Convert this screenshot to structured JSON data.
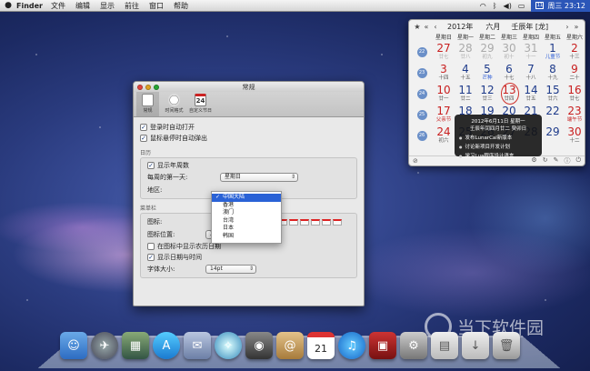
{
  "menubar": {
    "app_name": "Finder",
    "items": [
      "文件",
      "编辑",
      "显示",
      "前往",
      "窗口",
      "帮助"
    ],
    "clock": "周三 23:12",
    "clock_icon": "calendar-icon"
  },
  "calendar": {
    "year": "2012年",
    "month": "六月",
    "ganzhi": "壬辰年 [龙]",
    "weekdays": [
      "星期日",
      "星期一",
      "星期二",
      "星期三",
      "星期四",
      "星期五",
      "星期六"
    ],
    "weeks": [
      {
        "num": "22",
        "days": [
          [
            "27",
            "廿七",
            1
          ],
          [
            "28",
            "廿八",
            1
          ],
          [
            "29",
            "初九",
            1
          ],
          [
            "30",
            "初十",
            1
          ],
          [
            "31",
            "十一",
            1
          ],
          [
            "1",
            "儿童节",
            0
          ],
          [
            "2",
            "十三",
            0
          ]
        ]
      },
      {
        "num": "23",
        "days": [
          [
            "3",
            "十四",
            0
          ],
          [
            "4",
            "十五",
            0
          ],
          [
            "5",
            "芒种",
            0
          ],
          [
            "6",
            "十七",
            0
          ],
          [
            "7",
            "十八",
            0
          ],
          [
            "8",
            "十九",
            0
          ],
          [
            "9",
            "二十",
            0
          ]
        ]
      },
      {
        "num": "24",
        "days": [
          [
            "10",
            "廿一",
            0
          ],
          [
            "11",
            "廿二",
            0
          ],
          [
            "12",
            "廿三",
            0
          ],
          [
            "13",
            "廿四",
            0
          ],
          [
            "14",
            "廿五",
            0
          ],
          [
            "15",
            "廿六",
            0
          ],
          [
            "16",
            "廿七",
            0
          ]
        ]
      },
      {
        "num": "25",
        "days": [
          [
            "17",
            "父亲节",
            0
          ],
          [
            "18",
            "",
            0
          ],
          [
            "19",
            "",
            0
          ],
          [
            "20",
            "",
            0
          ],
          [
            "21",
            "",
            0
          ],
          [
            "22",
            "",
            0
          ],
          [
            "23",
            "端午节",
            0
          ]
        ]
      },
      {
        "num": "26",
        "days": [
          [
            "24",
            "初六",
            0
          ],
          [
            "25",
            "",
            0
          ],
          [
            "26",
            "",
            0
          ],
          [
            "27",
            "",
            0
          ],
          [
            "28",
            "",
            0
          ],
          [
            "29",
            "",
            0
          ],
          [
            "30",
            "十二",
            0
          ]
        ]
      }
    ],
    "tooltip": {
      "title": "2012年6月11日 星期一",
      "subtitle": "壬辰年闰四月廿二 癸卯日",
      "items": [
        "发布LunarCal新版本",
        "讨论新项目开发计划",
        "学习Lua程序设计语言"
      ]
    }
  },
  "prefs": {
    "title": "常规",
    "toolbar": [
      "常规",
      "时间格式",
      "自定义节日"
    ],
    "options": {
      "login_open": "登录时自动打开",
      "hover_popup": "鼠标悬停时自动弹出"
    },
    "calendar_group": {
      "label": "日历",
      "show_weeknum": "显示年周数",
      "first_day_label": "每周的第一天:",
      "first_day_value": "星期日",
      "region_label": "地区:"
    },
    "menubar_group": {
      "label": "菜单栏",
      "icon_label": "图标:",
      "icon_pos_label": "图标位置:",
      "icon_pos_value": "左",
      "show_lunar": "在图标中显示农历日期",
      "show_datetime": "显示日期与时间",
      "font_size_label": "字体大小:",
      "font_size_value": "14pt"
    },
    "region_options": [
      "中国大陆",
      "香港",
      "澳门",
      "台湾",
      "日本",
      "韩国"
    ],
    "region_selected": "中国大陆"
  },
  "watermark": "当下软件园"
}
